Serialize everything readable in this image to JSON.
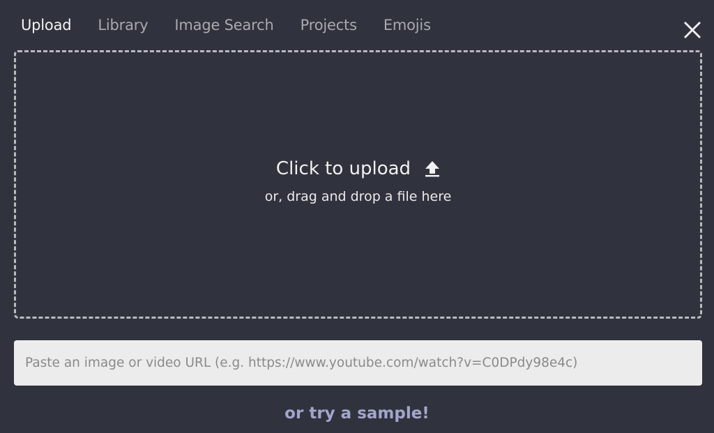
{
  "tabs": [
    {
      "label": "Upload",
      "active": true
    },
    {
      "label": "Library",
      "active": false
    },
    {
      "label": "Image Search",
      "active": false
    },
    {
      "label": "Projects",
      "active": false
    },
    {
      "label": "Emojis",
      "active": false
    }
  ],
  "close_icon": "close-icon",
  "dropzone": {
    "title": "Click to upload",
    "icon": "upload-arrow-icon",
    "subtitle": "or, drag and drop a file here"
  },
  "url_input": {
    "value": "",
    "placeholder": "Paste an image or video URL (e.g. https://www.youtube.com/watch?v=C0DPdy98e4c)"
  },
  "sample_link": "or try a sample!"
}
